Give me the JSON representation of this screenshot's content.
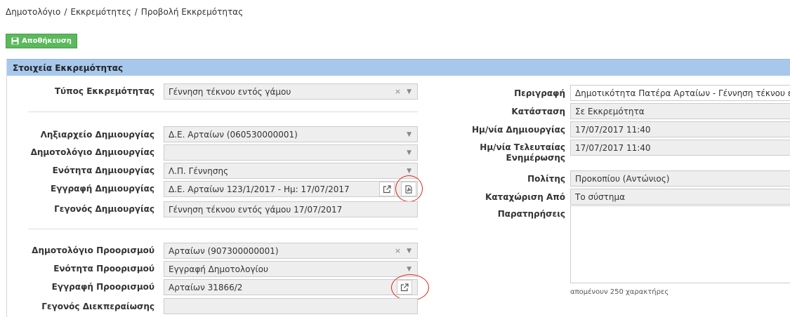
{
  "breadcrumb": [
    "Δημοτολόγιο",
    "Εκκρεμότητες",
    "Προβολή Εκκρεμότητας"
  ],
  "toolbar": {
    "save_label": "Αποθήκευση"
  },
  "panel": {
    "title": "Στοιχεία Εκκρεμότητας"
  },
  "left": {
    "type": {
      "label": "Τύπος Εκκρεμότητας",
      "value": "Γέννηση τέκνου εντός γάμου"
    },
    "creation_registry": {
      "label": "Ληξιαρχείο Δημιουργίας",
      "value": "Δ.Ε. Αρταίων (060530000001)"
    },
    "creation_municipal_registry": {
      "label": "Δημοτολόγιο Δημιουργίας",
      "value": ""
    },
    "creation_section": {
      "label": "Ενότητα Δημιουργίας",
      "value": "Λ.Π. Γέννησης"
    },
    "creation_record": {
      "label": "Εγγραφή Δημιουργίας",
      "value": "Δ.Ε. Αρταίων 123/1/2017 - Ημ: 17/07/2017"
    },
    "creation_event": {
      "label": "Γεγονός Δημιουργίας",
      "value": "Γέννηση τέκνου εντός γάμου 17/07/2017"
    },
    "dest_registry": {
      "label": "Δημοτολόγιο Προορισμού",
      "value": "Αρταίων (907300000001)"
    },
    "dest_section": {
      "label": "Ενότητα Προορισμού",
      "value": "Εγγραφή Δημοτολογίου"
    },
    "dest_record": {
      "label": "Εγγραφή Προορισμού",
      "value": "Αρταίων 31866/2"
    },
    "completion_event": {
      "label": "Γεγονός Διεκπεραίωσης",
      "value": ""
    }
  },
  "right": {
    "description": {
      "label": "Περιγραφή",
      "value": "Δημοτικότητα Πατέρα Αρταίων - Γέννηση τέκνου εντ"
    },
    "status": {
      "label": "Κατάσταση",
      "value": "Σε Εκκρεμότητα"
    },
    "created": {
      "label": "Ημ/νία Δημιουργίας",
      "value": "17/07/2017 11:40"
    },
    "updated": {
      "label_line1": "Ημ/νία Τελευταίας",
      "label_line2": "Ενημέρωσης",
      "value": "17/07/2017 11:40"
    },
    "citizen": {
      "label": "Πολίτης",
      "value": "Προκοπίου (Αντώνιος)"
    },
    "entered_by": {
      "label": "Καταχώριση Από",
      "value": "Το σύστημα"
    },
    "notes": {
      "label": "Παρατηρήσεις",
      "value": "",
      "remaining_hint": "απομένουν 250 χαρακτήρες"
    }
  },
  "glyphs": {
    "clear": "×",
    "caret": "▼"
  },
  "icons": [
    "save-icon",
    "external-link-icon",
    "pdf-icon",
    "clear-icon",
    "chevron-down-icon"
  ],
  "colors": {
    "header_bg": "#a7c8ec",
    "save_button": "#5cb85c",
    "highlight_circle": "#e0251b",
    "field_bg": "#eeeeee"
  }
}
